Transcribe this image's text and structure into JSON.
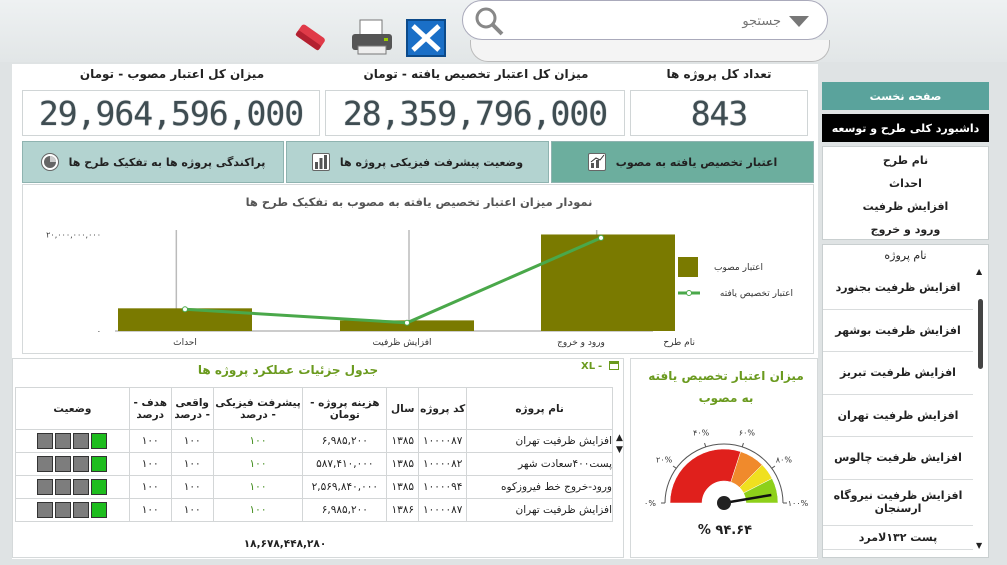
{
  "toolbar": {
    "search_placeholder": "جستجو",
    "icons": [
      "eraser-icon",
      "printer-icon",
      "excel-icon"
    ]
  },
  "kpis": [
    {
      "title": "تعداد کل پروژه ها",
      "value": "843"
    },
    {
      "title": "میزان کل اعتبار تخصیص یافته - تومان",
      "value": "28,359,796,000"
    },
    {
      "title": "میزان کل اعتبار مصوب - تومان",
      "value": "29,964,596,000"
    }
  ],
  "tabs": [
    {
      "label": "اعتبار تخصیص یافته به مصوب",
      "active": true
    },
    {
      "label": "وضعیت پیشرفت فیزیکی پروژه ها",
      "active": false
    },
    {
      "label": "پراکندگی پروژه ها به تفکیک طرح ها",
      "active": false
    }
  ],
  "nav": {
    "home": "صفحه نخست",
    "dashboard": "داشبورد کلی طرح و توسعه"
  },
  "filters": {
    "header": "نام طرح",
    "items": [
      "احداث",
      "افزایش ظرفیت",
      "ورود و خروج"
    ]
  },
  "projects": {
    "header": "نام پروژه",
    "items": [
      "افزایش ظرفیت بجنورد",
      "افزایش ظرفیت بوشهر",
      "افزایش ظرفیت تبریز",
      "افزایش ظرفیت تهران",
      "افزایش ظرفیت چالوس",
      "افزایش ظرفیت نیروگاه ارسنجان",
      "پست ۱۳۲لامرد"
    ]
  },
  "chart_data": {
    "type": "bar",
    "title": "نمودار میزان اعتبار تخصیص یافته به مصوب به تفکیک طرح ها",
    "xlabel": "نام طرح",
    "categories": [
      "احداث",
      "افزایش ظرفیت",
      "ورود و خروج"
    ],
    "y_tick_labels": [
      "۰",
      "۲۰,۰۰۰,۰۰۰,۰۰۰"
    ],
    "ylim": [
      0,
      23000000000
    ],
    "series": [
      {
        "name": "اعتبار مصوب",
        "kind": "bar",
        "color": "#7a7a00",
        "values": [
          4700000000,
          2200000000,
          20000000000
        ]
      },
      {
        "name": "اعتبار تخصیص یافته",
        "kind": "line",
        "color": "#4aa84a",
        "values": [
          4500000000,
          1700000000,
          19300000000
        ]
      }
    ],
    "legend": "right",
    "grid": true
  },
  "gauge": {
    "title": "میزان اعتبار تخصیص یافته به مصوب",
    "value_label": "% ۹۴.۶۴",
    "value": 94.64,
    "tick_labels": [
      "۰%",
      "۲۰%",
      "۴۰%",
      "۶۰%",
      "۸۰%",
      "۱۰۰%"
    ],
    "bands": [
      "#e0201c",
      "#f08a2c",
      "#f0e020",
      "#8ed01a"
    ]
  },
  "table": {
    "title": "جدول جزئیات عملکرد پروژه ها",
    "headers": [
      "نام پروژه",
      "کد پروژه",
      "سال",
      "هزینه پروژه - تومان",
      "پیشرفت فیزیکی - درصد",
      "واقعی - درصد",
      "هدف - درصد",
      "وضعیت"
    ],
    "rows": [
      {
        "name": "افزایش ظرفیت تهران",
        "code": "۱۰۰۰۰۸۷",
        "year": "۱۳۸۵",
        "cost": "۶,۹۸۵,۲۰۰",
        "progress": "۱۰۰",
        "actual": "۱۰۰",
        "target": "۱۰۰",
        "leds": [
          false,
          false,
          false,
          true
        ]
      },
      {
        "name": "پست۴۰۰سعادت شهر",
        "code": "۱۰۰۰۰۸۲",
        "year": "۱۳۸۵",
        "cost": "۵۸۷,۴۱۰,۰۰۰",
        "progress": "۱۰۰",
        "actual": "۱۰۰",
        "target": "۱۰۰",
        "leds": [
          false,
          false,
          false,
          true
        ]
      },
      {
        "name": "ورود-خروج خط فیروزکوه",
        "code": "۱۰۰۰۰۹۴",
        "year": "۱۳۸۵",
        "cost": "۲,۵۶۹,۸۴۰,۰۰۰",
        "progress": "۱۰۰",
        "actual": "۱۰۰",
        "target": "۱۰۰",
        "leds": [
          false,
          false,
          false,
          true
        ]
      },
      {
        "name": "افزایش ظرفیت تهران",
        "code": "۱۰۰۰۰۸۷",
        "year": "۱۳۸۶",
        "cost": "۶,۹۸۵,۲۰۰",
        "progress": "۱۰۰",
        "actual": "۱۰۰",
        "target": "۱۰۰",
        "leds": [
          false,
          false,
          false,
          true
        ]
      }
    ],
    "total": "۱۸,۶۷۸,۴۴۸,۲۸۰"
  },
  "colors": {
    "accent": "#5aa39c",
    "active_tab": "#6cae9e",
    "inactive_tab": "#b3d3d0",
    "bar": "#7a7a00",
    "line": "#4aa84a"
  }
}
